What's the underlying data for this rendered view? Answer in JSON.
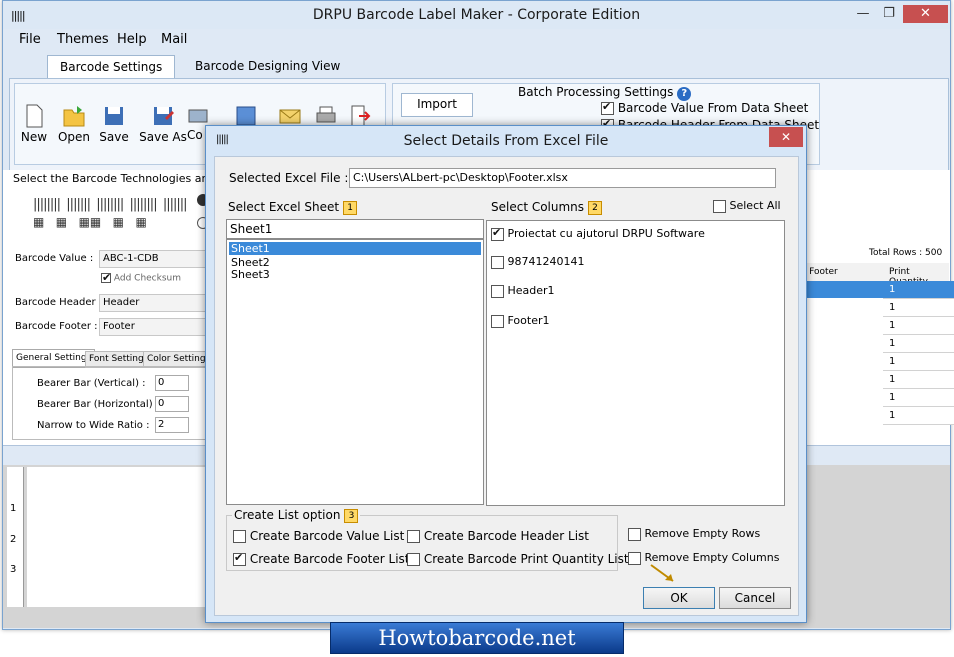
{
  "app": {
    "title": "DRPU Barcode Label Maker - Corporate Edition",
    "controls": {
      "minimize": "—",
      "maximize": "❐",
      "close": "✕"
    }
  },
  "menu": [
    "File",
    "Themes",
    "Help",
    "Mail"
  ],
  "tabs": [
    "Barcode Settings",
    "Barcode Designing View"
  ],
  "toolbar": {
    "buttons": [
      "New",
      "Open",
      "Save",
      "Save As",
      "Co"
    ],
    "import_tab": "Import",
    "batch": {
      "title": "Batch Processing Settings",
      "options": [
        {
          "label": "Barcode Value From Data Sheet",
          "checked": true
        },
        {
          "label": "Barcode Header From Data Sheet",
          "checked": true
        }
      ]
    }
  },
  "left_panel": {
    "tech_label": "Select the Barcode Technologies and Ty",
    "barcode_value_label": "Barcode Value :",
    "barcode_value": "ABC-1-CDB",
    "add_checksum": "Add Checksum",
    "header_label": "Barcode Header :",
    "header_value": "Header",
    "footer_label": "Barcode Footer :",
    "footer_value": "Footer",
    "sub_tabs": [
      "General Settings",
      "Font Settings",
      "Color Settings"
    ],
    "settings": [
      {
        "label": "Bearer Bar (Vertical) :",
        "value": "0"
      },
      {
        "label": "Bearer Bar (Horizontal) :",
        "value": "0"
      },
      {
        "label": "Narrow to Wide Ratio :",
        "value": "2"
      }
    ],
    "ruler": [
      "1",
      "2",
      "3"
    ]
  },
  "right_grid": {
    "total_rows": "Total Rows : 500",
    "col_footer": "de Footer",
    "col_qty": "Print Quantity",
    "rows": [
      "1",
      "1",
      "1",
      "1",
      "1",
      "1",
      "1",
      "1"
    ]
  },
  "dialog": {
    "title": "Select Details From Excel File",
    "close": "✕",
    "file_label": "Selected Excel File :",
    "file_path": "C:\\Users\\ALbert-pc\\Desktop\\Footer.xlsx",
    "sheet_label": "Select Excel Sheet",
    "sheet_num": "1",
    "sheet_current": "Sheet1",
    "sheets": [
      "Sheet1",
      "Sheet2",
      "Sheet3"
    ],
    "columns_label": "Select  Columns",
    "columns_num": "2",
    "select_all": "Select All",
    "columns": [
      {
        "label": "Proiectat cu ajutorul DRPU Software",
        "checked": true
      },
      {
        "label": "98741240141",
        "checked": false
      },
      {
        "label": "Header1",
        "checked": false
      },
      {
        "label": "Footer1",
        "checked": false
      }
    ],
    "list_option_label": "Create List option",
    "list_option_num": "3",
    "list_options": [
      {
        "label": "Create Barcode Value List",
        "checked": false
      },
      {
        "label": "Create Barcode Header List",
        "checked": false
      },
      {
        "label": "Create Barcode Footer List",
        "checked": true
      },
      {
        "label": "Create Barcode Print Quantity List",
        "checked": false
      }
    ],
    "remove_rows": "Remove Empty Rows",
    "remove_cols": "Remove Empty Columns",
    "ok": "OK",
    "cancel": "Cancel"
  },
  "banner": "Howtobarcode.net"
}
